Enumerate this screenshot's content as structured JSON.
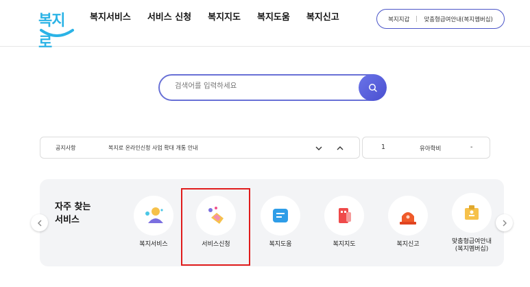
{
  "header": {
    "logo_text": "복지로",
    "nav": [
      "복지서비스",
      "서비스 신청",
      "복지지도",
      "복지도움",
      "복지신고"
    ],
    "util": [
      "복지지갑",
      "맞춤형급여안내(복지멤버십)"
    ]
  },
  "search": {
    "placeholder": "검색어를 입력하세요",
    "button_icon": "search-icon"
  },
  "notice": {
    "category": "공지사항",
    "text": "복지로 온라인신청 사업 확대 개통 안내"
  },
  "ranking": {
    "rank": "1",
    "name": "유아학비",
    "change": "-"
  },
  "frequent": {
    "title": "자주 찾는\n서비스",
    "items": [
      {
        "label": "복지서비스",
        "icon": "people-icon"
      },
      {
        "label": "서비스신청",
        "icon": "hand-pointer-icon"
      },
      {
        "label": "복지도움",
        "icon": "document-icon"
      },
      {
        "label": "복지지도",
        "icon": "map-icon"
      },
      {
        "label": "복지신고",
        "icon": "siren-icon"
      },
      {
        "label": "맞춤형급여안내\n(복지멤버십)",
        "icon": "membership-icon"
      }
    ]
  },
  "colors": {
    "accent": "#4a55c8",
    "highlight": "#e01b1b"
  }
}
